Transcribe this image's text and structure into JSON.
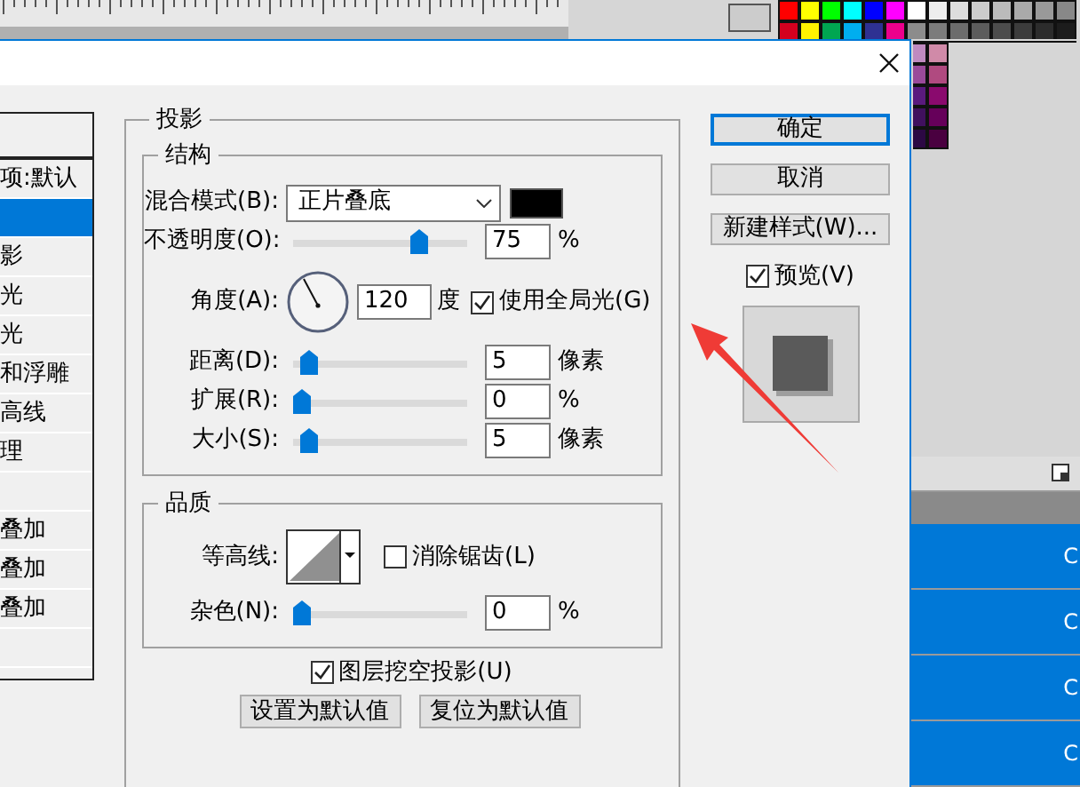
{
  "styles_list": [
    {
      "selected": false
    },
    {
      "label": "项:默认",
      "selected": false
    },
    {
      "selected": true
    },
    {
      "label": "影",
      "selected": false
    },
    {
      "label": "光",
      "selected": false
    },
    {
      "label": "光",
      "selected": false
    },
    {
      "label": "和浮雕",
      "selected": false
    },
    {
      "label": "高线",
      "selected": false
    },
    {
      "label": "理",
      "selected": false
    },
    {
      "selected": false
    },
    {
      "label": "叠加",
      "selected": false
    },
    {
      "label": "叠加",
      "selected": false
    },
    {
      "label": "叠加",
      "selected": false
    },
    {
      "selected": false
    }
  ],
  "drop_shadow": {
    "title": "投影",
    "structure": {
      "title": "结构",
      "blend_mode": {
        "label": "混合模式(B):",
        "value": "正片叠底",
        "color": "#000000"
      },
      "opacity": {
        "label": "不透明度(O):",
        "level": 0.75,
        "value": "75",
        "unit": "%"
      },
      "angle": {
        "label": "角度(A):",
        "value": "120",
        "unit": "度",
        "global_light": {
          "label": "使用全局光(G)",
          "checked": true
        }
      },
      "sliders": [
        {
          "label": "距离(D):",
          "level": 0.05,
          "value": "5",
          "unit": "像素"
        },
        {
          "label": "扩展(R):",
          "level": 0,
          "value": "0",
          "unit": "%"
        },
        {
          "label": "大小(S):",
          "level": 0.05,
          "value": "5",
          "unit": "像素"
        }
      ]
    },
    "quality": {
      "title": "品质",
      "contour": {
        "label": "等高线:"
      },
      "anti_aliased": {
        "label": "消除锯齿(L)",
        "checked": false
      },
      "noise": {
        "label": "杂色(N):",
        "level": 0,
        "value": "0",
        "unit": "%"
      }
    },
    "knockout": {
      "label": "图层挖空投影(U)",
      "checked": true
    },
    "default_buttons": [
      "设置为默认值",
      "复位为默认值"
    ]
  },
  "buttons": [
    {
      "label": "确定",
      "default": true
    },
    {
      "label": "取消",
      "default": false
    },
    {
      "label": "新建样式(W)...",
      "default": false
    }
  ],
  "preview": {
    "label": "预览(V)",
    "checked": true
  },
  "layers": [
    {
      "text": "C"
    },
    {
      "text": "C"
    },
    {
      "text": "C"
    },
    {
      "text": "C"
    }
  ]
}
